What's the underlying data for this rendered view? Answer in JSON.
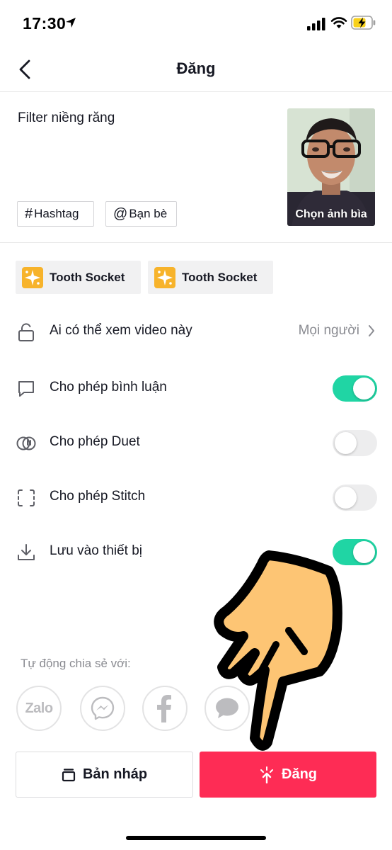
{
  "status_bar": {
    "time": "17:30"
  },
  "header": {
    "title": "Đăng"
  },
  "post": {
    "caption": "Filter niềng răng",
    "hashtag_symbol": "#",
    "hashtag_label": "Hashtag",
    "mention_symbol": "@",
    "mention_label": "Bạn bè",
    "cover_label": "Chọn ảnh bìa"
  },
  "effects": [
    {
      "label": "Tooth Socket"
    },
    {
      "label": "Tooth Socket"
    }
  ],
  "settings": {
    "privacy": {
      "label": "Ai có thể xem video này",
      "value": "Mọi người"
    },
    "comments": {
      "label": "Cho phép bình luận",
      "enabled": true
    },
    "duet": {
      "label": "Cho phép Duet",
      "enabled": false
    },
    "stitch": {
      "label": "Cho phép Stitch",
      "enabled": false
    },
    "save": {
      "label": "Lưu vào thiết bị",
      "enabled": true
    }
  },
  "share": {
    "title": "Tự động chia sẻ với:",
    "zalo_text": "Zalo",
    "targets": [
      "zalo-icon",
      "messenger-icon",
      "facebook-icon",
      "message-icon"
    ]
  },
  "actions": {
    "draft_label": "Bản nháp",
    "post_label": "Đăng"
  },
  "colors": {
    "accent": "#fe2c55",
    "toggle_on": "#20d5a4",
    "toggle_off": "#ededee",
    "effect_icon": "#f7b32b"
  }
}
